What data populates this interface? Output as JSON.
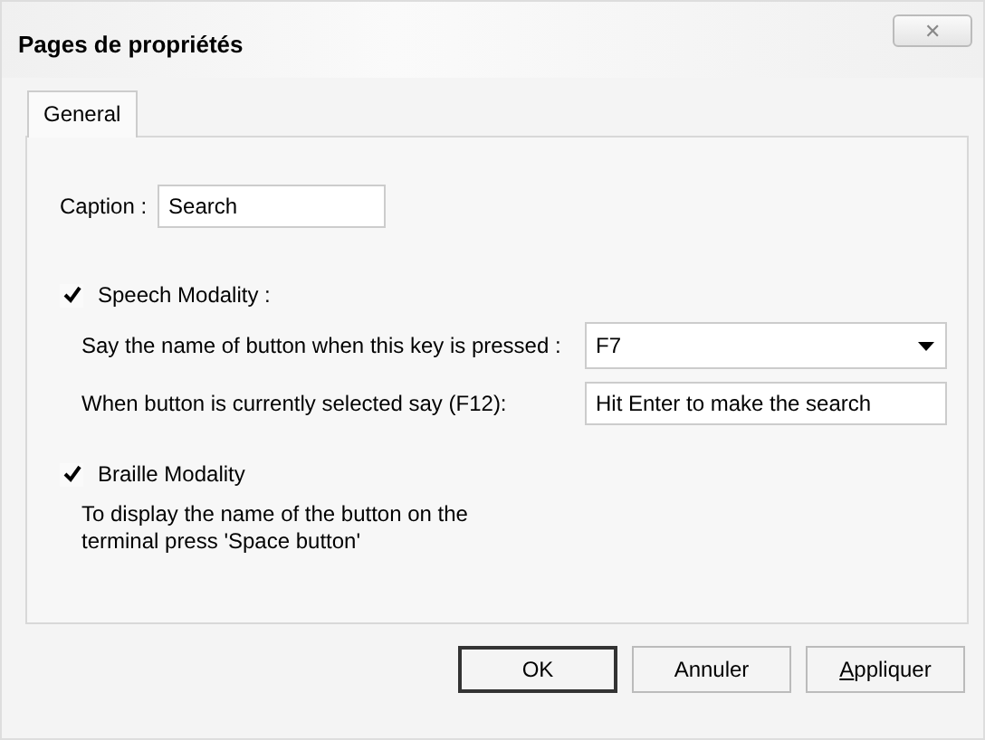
{
  "window": {
    "title": "Pages de propriétés",
    "close": "✕"
  },
  "tabs": [
    {
      "label": "General",
      "selected": true
    }
  ],
  "caption": {
    "label": "Caption :",
    "value": "Search"
  },
  "speech": {
    "label": "Speech Modality :",
    "checked": true,
    "key_label": "Say the name of button when this key is pressed :",
    "key_value": "F7",
    "say_label": "When button is currently selected say (F12):",
    "say_value": "Hit Enter to make the search"
  },
  "braille": {
    "label": "Braille Modality",
    "checked": true,
    "description": [
      "To display the name of the button on the",
      "terminal press 'Space button'"
    ]
  },
  "buttons": [
    {
      "label": "OK",
      "default": true
    },
    {
      "label": "Annuler",
      "default": false
    },
    {
      "label": "Appliquer",
      "default": false
    }
  ]
}
